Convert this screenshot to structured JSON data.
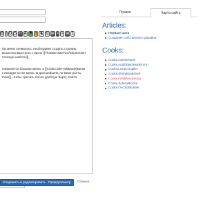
{
  "editor": {
    "paragraph1": "бы меню появилось, необходимо создать страниц\nмосистем Быстрого старта: [[ThisSite:SiteTwo/SiteIntro/Ит\nплоскую шаблон]]",
    "paragraph2": "появляется боковое меню, в [[Cooks:Site-editMode]меню\nк вкладке по же меню. В дальнейшем, по мере роста\nPack]], чтобы сделать более удобную Карту Сайта."
  },
  "toolbar": {
    "buttons": [
      "B",
      "I",
      "U",
      "S",
      "H",
      "A",
      "⚑",
      "⚡",
      "♞",
      "⇆",
      "⊞",
      "«",
      "»",
      "⊞",
      "1"
    ]
  },
  "tags": {
    "placeholder": "Ключи"
  },
  "actions": {
    "save_edit_label": "Сохранить и редактировать",
    "preview_label": "Предпросмотр",
    "cancel_label": "Отмена"
  },
  "sidebar": {
    "tabs": [
      {
        "label": "Правки"
      },
      {
        "label": "Карта сайта"
      }
    ],
    "articles_heading": "Articles:",
    "articles": [
      {
        "label": "Первые шаги",
        "style": "bold"
      },
      {
        "label": "Создание собственного дизайна",
        "style": "normal"
      }
    ],
    "cooks_heading": "Cooks:",
    "cooks": [
      {
        "label": "Cooks.AdminPanel",
        "style": "normal"
      },
      {
        "label": "Cooks.AddObjectModsForm",
        "style": "normal"
      },
      {
        "label": "Cooks.LessCompiler",
        "style": "normal"
      },
      {
        "label": "Cooks.ShinyBookshelf",
        "style": "normal"
      },
      {
        "label": "Cooks.FieldPrecessing",
        "style": "red"
      },
      {
        "label": "Cooks.SolveoBlocks",
        "style": "normal"
      },
      {
        "label": "Cooks.OnClickBuilder",
        "style": "normal"
      }
    ]
  }
}
